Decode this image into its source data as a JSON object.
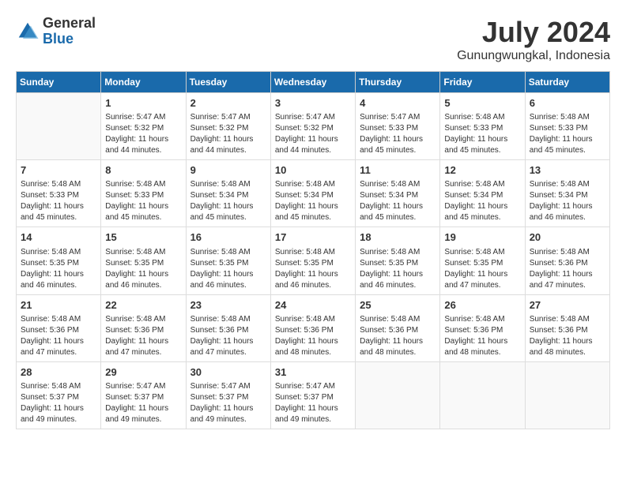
{
  "logo": {
    "text_general": "General",
    "text_blue": "Blue"
  },
  "title": {
    "month_year": "July 2024",
    "location": "Gunungwungkal, Indonesia"
  },
  "headers": [
    "Sunday",
    "Monday",
    "Tuesday",
    "Wednesday",
    "Thursday",
    "Friday",
    "Saturday"
  ],
  "weeks": [
    [
      {
        "day": "",
        "info": ""
      },
      {
        "day": "1",
        "info": "Sunrise: 5:47 AM\nSunset: 5:32 PM\nDaylight: 11 hours\nand 44 minutes."
      },
      {
        "day": "2",
        "info": "Sunrise: 5:47 AM\nSunset: 5:32 PM\nDaylight: 11 hours\nand 44 minutes."
      },
      {
        "day": "3",
        "info": "Sunrise: 5:47 AM\nSunset: 5:32 PM\nDaylight: 11 hours\nand 44 minutes."
      },
      {
        "day": "4",
        "info": "Sunrise: 5:47 AM\nSunset: 5:33 PM\nDaylight: 11 hours\nand 45 minutes."
      },
      {
        "day": "5",
        "info": "Sunrise: 5:48 AM\nSunset: 5:33 PM\nDaylight: 11 hours\nand 45 minutes."
      },
      {
        "day": "6",
        "info": "Sunrise: 5:48 AM\nSunset: 5:33 PM\nDaylight: 11 hours\nand 45 minutes."
      }
    ],
    [
      {
        "day": "7",
        "info": "Sunrise: 5:48 AM\nSunset: 5:33 PM\nDaylight: 11 hours\nand 45 minutes."
      },
      {
        "day": "8",
        "info": "Sunrise: 5:48 AM\nSunset: 5:33 PM\nDaylight: 11 hours\nand 45 minutes."
      },
      {
        "day": "9",
        "info": "Sunrise: 5:48 AM\nSunset: 5:34 PM\nDaylight: 11 hours\nand 45 minutes."
      },
      {
        "day": "10",
        "info": "Sunrise: 5:48 AM\nSunset: 5:34 PM\nDaylight: 11 hours\nand 45 minutes."
      },
      {
        "day": "11",
        "info": "Sunrise: 5:48 AM\nSunset: 5:34 PM\nDaylight: 11 hours\nand 45 minutes."
      },
      {
        "day": "12",
        "info": "Sunrise: 5:48 AM\nSunset: 5:34 PM\nDaylight: 11 hours\nand 45 minutes."
      },
      {
        "day": "13",
        "info": "Sunrise: 5:48 AM\nSunset: 5:34 PM\nDaylight: 11 hours\nand 46 minutes."
      }
    ],
    [
      {
        "day": "14",
        "info": "Sunrise: 5:48 AM\nSunset: 5:35 PM\nDaylight: 11 hours\nand 46 minutes."
      },
      {
        "day": "15",
        "info": "Sunrise: 5:48 AM\nSunset: 5:35 PM\nDaylight: 11 hours\nand 46 minutes."
      },
      {
        "day": "16",
        "info": "Sunrise: 5:48 AM\nSunset: 5:35 PM\nDaylight: 11 hours\nand 46 minutes."
      },
      {
        "day": "17",
        "info": "Sunrise: 5:48 AM\nSunset: 5:35 PM\nDaylight: 11 hours\nand 46 minutes."
      },
      {
        "day": "18",
        "info": "Sunrise: 5:48 AM\nSunset: 5:35 PM\nDaylight: 11 hours\nand 46 minutes."
      },
      {
        "day": "19",
        "info": "Sunrise: 5:48 AM\nSunset: 5:35 PM\nDaylight: 11 hours\nand 47 minutes."
      },
      {
        "day": "20",
        "info": "Sunrise: 5:48 AM\nSunset: 5:36 PM\nDaylight: 11 hours\nand 47 minutes."
      }
    ],
    [
      {
        "day": "21",
        "info": "Sunrise: 5:48 AM\nSunset: 5:36 PM\nDaylight: 11 hours\nand 47 minutes."
      },
      {
        "day": "22",
        "info": "Sunrise: 5:48 AM\nSunset: 5:36 PM\nDaylight: 11 hours\nand 47 minutes."
      },
      {
        "day": "23",
        "info": "Sunrise: 5:48 AM\nSunset: 5:36 PM\nDaylight: 11 hours\nand 47 minutes."
      },
      {
        "day": "24",
        "info": "Sunrise: 5:48 AM\nSunset: 5:36 PM\nDaylight: 11 hours\nand 48 minutes."
      },
      {
        "day": "25",
        "info": "Sunrise: 5:48 AM\nSunset: 5:36 PM\nDaylight: 11 hours\nand 48 minutes."
      },
      {
        "day": "26",
        "info": "Sunrise: 5:48 AM\nSunset: 5:36 PM\nDaylight: 11 hours\nand 48 minutes."
      },
      {
        "day": "27",
        "info": "Sunrise: 5:48 AM\nSunset: 5:36 PM\nDaylight: 11 hours\nand 48 minutes."
      }
    ],
    [
      {
        "day": "28",
        "info": "Sunrise: 5:48 AM\nSunset: 5:37 PM\nDaylight: 11 hours\nand 49 minutes."
      },
      {
        "day": "29",
        "info": "Sunrise: 5:47 AM\nSunset: 5:37 PM\nDaylight: 11 hours\nand 49 minutes."
      },
      {
        "day": "30",
        "info": "Sunrise: 5:47 AM\nSunset: 5:37 PM\nDaylight: 11 hours\nand 49 minutes."
      },
      {
        "day": "31",
        "info": "Sunrise: 5:47 AM\nSunset: 5:37 PM\nDaylight: 11 hours\nand 49 minutes."
      },
      {
        "day": "",
        "info": ""
      },
      {
        "day": "",
        "info": ""
      },
      {
        "day": "",
        "info": ""
      }
    ]
  ]
}
